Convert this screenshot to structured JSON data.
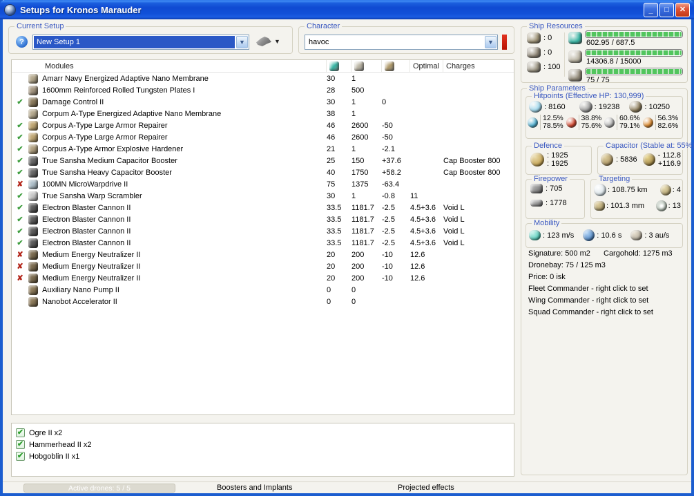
{
  "window": {
    "title": "Setups for Kronos Marauder",
    "minimize_glyph": "_",
    "maximize_glyph": "□",
    "close_glyph": "✕"
  },
  "setup": {
    "label": "Current Setup",
    "value": "New Setup 1"
  },
  "character": {
    "label": "Character",
    "value": "havoc"
  },
  "resources": {
    "label": "Ship Resources",
    "slots": [
      {
        "icon": "turret-hardpoints-icon",
        "color": "#9a8f72",
        "value": ": 0"
      },
      {
        "icon": "launcher-hardpoints-icon",
        "color": "#8b8272",
        "value": ": 0"
      },
      {
        "icon": "rig-slots-icon",
        "color": "#97907e",
        "value": ": 100"
      }
    ],
    "bars": [
      {
        "icon": "cpu-icon",
        "color": "#35b3a2",
        "text": "602.95 / 687.5",
        "fill": 100
      },
      {
        "icon": "powergrid-icon",
        "color": "#b9b3a2",
        "text": "14306.8 / 15000",
        "fill": 100
      },
      {
        "icon": "calibration-icon",
        "color": "#8d8574",
        "text": "75 / 75",
        "fill": 100
      }
    ]
  },
  "parameters": {
    "label": "Ship Parameters",
    "hitpoints": {
      "label": "Hitpoints (Effective HP: 130,999)",
      "pools": [
        {
          "icon": "shield-icon",
          "color": "#9fd8ee",
          "value": ": 8160"
        },
        {
          "icon": "armor-icon",
          "color": "#9b9b9b",
          "value": ": 19238"
        },
        {
          "icon": "structure-icon",
          "color": "#8a7a58",
          "value": ": 10250"
        }
      ],
      "resists": [
        {
          "icon": "em-resist-icon",
          "color": "#4fb4d8",
          "top": "12.5%",
          "bottom": "78.5%"
        },
        {
          "icon": "thermal-resist-icon",
          "color": "#d8442a",
          "top": "38.8%",
          "bottom": "75.6%"
        },
        {
          "icon": "kinetic-resist-icon",
          "color": "#b8b8b8",
          "top": "60.6%",
          "bottom": "79.1%"
        },
        {
          "icon": "explosive-resist-icon",
          "color": "#e08a2c",
          "top": "56.3%",
          "bottom": "82.6%"
        }
      ]
    },
    "defence": {
      "label": "Defence",
      "icon": "defence-icon",
      "icon_color": "#c8a85a",
      "top": ": 1925",
      "bottom": ": 1925"
    },
    "capacitor": {
      "label": "Capacitor (Stable at: 55%)",
      "icon": "capacitor-icon",
      "icon_color": "#b09a6a",
      "amount": ": 5836",
      "delta_icon": "cap-recharge-icon",
      "delta_color": "#a88e4e",
      "delta_top": "- 112.8",
      "delta_bottom": "+116.9"
    },
    "firepower": {
      "label": "Firepower",
      "dps_icon": "turret-dps-icon",
      "dps_color": "#8f8f8f",
      "dps": ": 705",
      "volley_icon": "volley-icon",
      "volley_color": "#9a9a9a",
      "volley": ": 1778"
    },
    "targeting": {
      "label": "Targeting",
      "range_icon": "targeting-range-icon",
      "range_color": "#dfe8ec",
      "range": ": 108.75 km",
      "targets_icon": "max-targets-icon",
      "targets_color": "#b8a878",
      "targets": ": 4",
      "scan_icon": "scan-resolution-icon",
      "scan_color": "#b0a070",
      "scan": ": 101.3 mm",
      "sensor_icon": "sensor-strength-icon",
      "sensor_color": "#cfd8cf",
      "sensor": ": 13"
    },
    "mobility": {
      "label": "Mobility",
      "speed_icon": "max-velocity-icon",
      "speed_color": "#5fd0c0",
      "speed": ": 123 m/s",
      "align_icon": "align-time-icon",
      "align_color": "#5a8ec8",
      "align": ": 10.6 s",
      "warp_icon": "warp-speed-icon",
      "warp_color": "#b8b0a0",
      "warp": ": 3 au/s"
    },
    "info_lines": [
      {
        "left": "Signature: 500 m2",
        "right": "Cargohold: 1275 m3"
      },
      {
        "left": "Dronebay: 75 / 125 m3",
        "right": ""
      },
      {
        "left": "Price: 0 isk",
        "right": ""
      },
      {
        "left": "Fleet Commander - right click to set",
        "right": ""
      },
      {
        "left": "Wing Commander - right click to set",
        "right": ""
      },
      {
        "left": "Squad Commander - right click to set",
        "right": ""
      }
    ]
  },
  "modules": {
    "headers": {
      "name": "Modules",
      "cpu_icon": "cpu-column-icon",
      "pg_icon": "powergrid-column-icon",
      "cap_icon": "capacitor-column-icon",
      "optimal": "Optimal",
      "charges": "Charges"
    },
    "header_icon_colors": {
      "cpu": "#35b3a2",
      "pg": "#b9b3a2",
      "cap": "#b09a6a"
    },
    "rows": [
      {
        "status": "",
        "icon": "module-icon",
        "color": "#b5a98e",
        "name": "Amarr Navy Energized Adaptive Nano Membrane",
        "cpu": "30",
        "pg": "1",
        "cap": "",
        "optimal": "",
        "charges": ""
      },
      {
        "status": "",
        "icon": "module-icon",
        "color": "#a59782",
        "name": "1600mm Reinforced Rolled Tungsten Plates I",
        "cpu": "28",
        "pg": "500",
        "cap": "",
        "optimal": "",
        "charges": ""
      },
      {
        "status": "ok",
        "icon": "module-icon",
        "color": "#8a7a5c",
        "name": "Damage Control II",
        "cpu": "30",
        "pg": "1",
        "cap": "0",
        "optimal": "",
        "charges": ""
      },
      {
        "status": "",
        "icon": "module-icon",
        "color": "#b5a98e",
        "name": "Corpum A-Type Energized Adaptive Nano Membrane",
        "cpu": "38",
        "pg": "1",
        "cap": "",
        "optimal": "",
        "charges": ""
      },
      {
        "status": "ok",
        "icon": "module-icon",
        "color": "#c0a774",
        "name": "Corpus A-Type Large Armor Repairer",
        "cpu": "46",
        "pg": "2600",
        "cap": "-50",
        "optimal": "",
        "charges": ""
      },
      {
        "status": "ok",
        "icon": "module-icon",
        "color": "#c0a774",
        "name": "Corpus A-Type Large Armor Repairer",
        "cpu": "46",
        "pg": "2600",
        "cap": "-50",
        "optimal": "",
        "charges": ""
      },
      {
        "status": "ok",
        "icon": "module-icon",
        "color": "#b0a080",
        "name": "Corpus A-Type Armor Explosive Hardener",
        "cpu": "21",
        "pg": "1",
        "cap": "-2.1",
        "optimal": "",
        "charges": ""
      },
      {
        "status": "ok",
        "icon": "module-icon",
        "color": "#6a6a6a",
        "name": "True Sansha Medium Capacitor Booster",
        "cpu": "25",
        "pg": "150",
        "cap": "+37.6",
        "optimal": "",
        "charges": "Cap Booster 800"
      },
      {
        "status": "ok",
        "icon": "module-icon",
        "color": "#6a6a6a",
        "name": "True Sansha Heavy Capacitor Booster",
        "cpu": "40",
        "pg": "1750",
        "cap": "+58.2",
        "optimal": "",
        "charges": "Cap Booster 800"
      },
      {
        "status": "off",
        "icon": "module-icon",
        "color": "#aebfc9",
        "name": "100MN MicroWarpdrive II",
        "cpu": "75",
        "pg": "1375",
        "cap": "-63.4",
        "optimal": "",
        "charges": ""
      },
      {
        "status": "ok",
        "icon": "module-icon",
        "color": "#c8c8c8",
        "name": "True Sansha Warp Scrambler",
        "cpu": "30",
        "pg": "1",
        "cap": "-0.8",
        "optimal": "11",
        "charges": ""
      },
      {
        "status": "ok",
        "icon": "module-icon",
        "color": "#5c5c5c",
        "name": "Electron Blaster Cannon II",
        "cpu": "33.5",
        "pg": "1181.7",
        "cap": "-2.5",
        "optimal": "4.5+3.6",
        "charges": "Void L"
      },
      {
        "status": "ok",
        "icon": "module-icon",
        "color": "#5c5c5c",
        "name": "Electron Blaster Cannon II",
        "cpu": "33.5",
        "pg": "1181.7",
        "cap": "-2.5",
        "optimal": "4.5+3.6",
        "charges": "Void L"
      },
      {
        "status": "ok",
        "icon": "module-icon",
        "color": "#5c5c5c",
        "name": "Electron Blaster Cannon II",
        "cpu": "33.5",
        "pg": "1181.7",
        "cap": "-2.5",
        "optimal": "4.5+3.6",
        "charges": "Void L"
      },
      {
        "status": "ok",
        "icon": "module-icon",
        "color": "#5c5c5c",
        "name": "Electron Blaster Cannon II",
        "cpu": "33.5",
        "pg": "1181.7",
        "cap": "-2.5",
        "optimal": "4.5+3.6",
        "charges": "Void L"
      },
      {
        "status": "off",
        "icon": "module-icon",
        "color": "#7c6c50",
        "name": "Medium Energy Neutralizer II",
        "cpu": "20",
        "pg": "200",
        "cap": "-10",
        "optimal": "12.6",
        "charges": ""
      },
      {
        "status": "off",
        "icon": "module-icon",
        "color": "#7c6c50",
        "name": "Medium Energy Neutralizer II",
        "cpu": "20",
        "pg": "200",
        "cap": "-10",
        "optimal": "12.6",
        "charges": ""
      },
      {
        "status": "off",
        "icon": "module-icon",
        "color": "#7c6c50",
        "name": "Medium Energy Neutralizer II",
        "cpu": "20",
        "pg": "200",
        "cap": "-10",
        "optimal": "12.6",
        "charges": ""
      },
      {
        "status": "",
        "icon": "rig-icon",
        "color": "#8c7a5a",
        "name": "Auxiliary Nano Pump II",
        "cpu": "0",
        "pg": "0",
        "cap": "",
        "optimal": "",
        "charges": ""
      },
      {
        "status": "",
        "icon": "rig-icon",
        "color": "#8c7a5a",
        "name": "Nanobot Accelerator II",
        "cpu": "0",
        "pg": "0",
        "cap": "",
        "optimal": "",
        "charges": ""
      }
    ]
  },
  "drones": {
    "items": [
      {
        "label": "Ogre II x2",
        "checked": true
      },
      {
        "label": "Hammerhead II x2",
        "checked": true
      },
      {
        "label": "Hobgoblin II x1",
        "checked": true
      }
    ]
  },
  "statusbar": {
    "active_drones": "Active drones: 5 / 5",
    "boosters": "Boosters and Implants",
    "projected": "Projected effects"
  }
}
